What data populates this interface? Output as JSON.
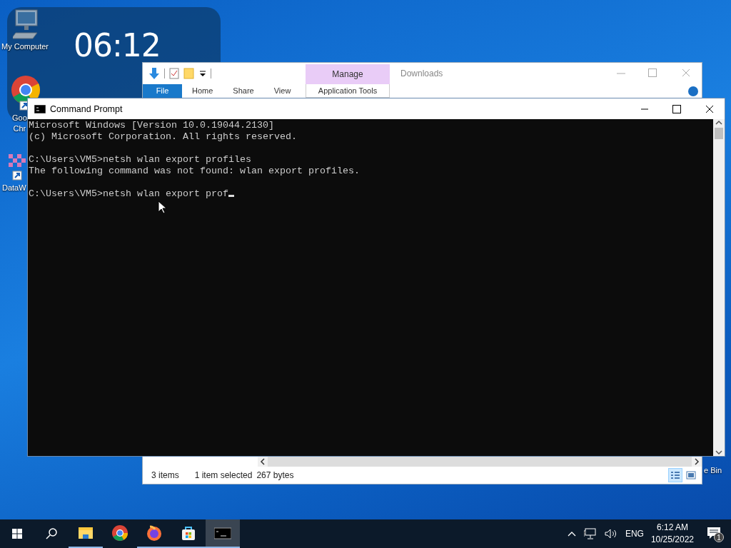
{
  "desktop_icons": [
    {
      "kind": "computer",
      "label_lines": [
        "My Computer"
      ]
    },
    {
      "kind": "chrome",
      "label_lines": [
        "Goo",
        "Chr"
      ]
    },
    {
      "kind": "app",
      "label_lines": [
        "DataW"
      ]
    },
    {
      "kind": "recycle",
      "label_lines": [
        "e Bin"
      ]
    }
  ],
  "clock_widget": {
    "time": "06:12"
  },
  "explorer": {
    "title": "Downloads",
    "ribbon_tabs": [
      {
        "kind": "file",
        "label": "File"
      },
      {
        "kind": "tab",
        "label": "Home"
      },
      {
        "kind": "tab",
        "label": "Share"
      },
      {
        "kind": "tab",
        "label": "View"
      }
    ],
    "context_tab": {
      "group": "Manage",
      "label": "Application Tools"
    },
    "status": {
      "items": "3 items",
      "selection": "1 item selected",
      "size": "267 bytes"
    },
    "views": [
      {
        "kind": "details",
        "selected": true
      },
      {
        "kind": "thumbnails",
        "selected": false
      }
    ]
  },
  "cmd": {
    "title": "Command Prompt",
    "blocks": [
      [
        "Microsoft Windows [Version 10.0.19044.2130]",
        "(c) Microsoft Corporation. All rights reserved."
      ],
      [
        "C:\\Users\\VM5>netsh wlan export profiles",
        "The following command was not found: wlan export profiles."
      ],
      [
        "C:\\Users\\VM5>netsh wlan export prof"
      ]
    ],
    "cursor": true
  },
  "taskbar": {
    "apps": [
      {
        "kind": "explorer",
        "running": true,
        "selected": false
      },
      {
        "kind": "chrome",
        "running": false,
        "selected": false
      },
      {
        "kind": "firefox",
        "running": true,
        "selected": false
      },
      {
        "kind": "store",
        "running": true,
        "selected": false
      },
      {
        "kind": "cmd",
        "running": true,
        "selected": true
      }
    ],
    "language": "ENG",
    "time": "6:12 AM",
    "date": "10/25/2022",
    "notification_count": "1"
  }
}
